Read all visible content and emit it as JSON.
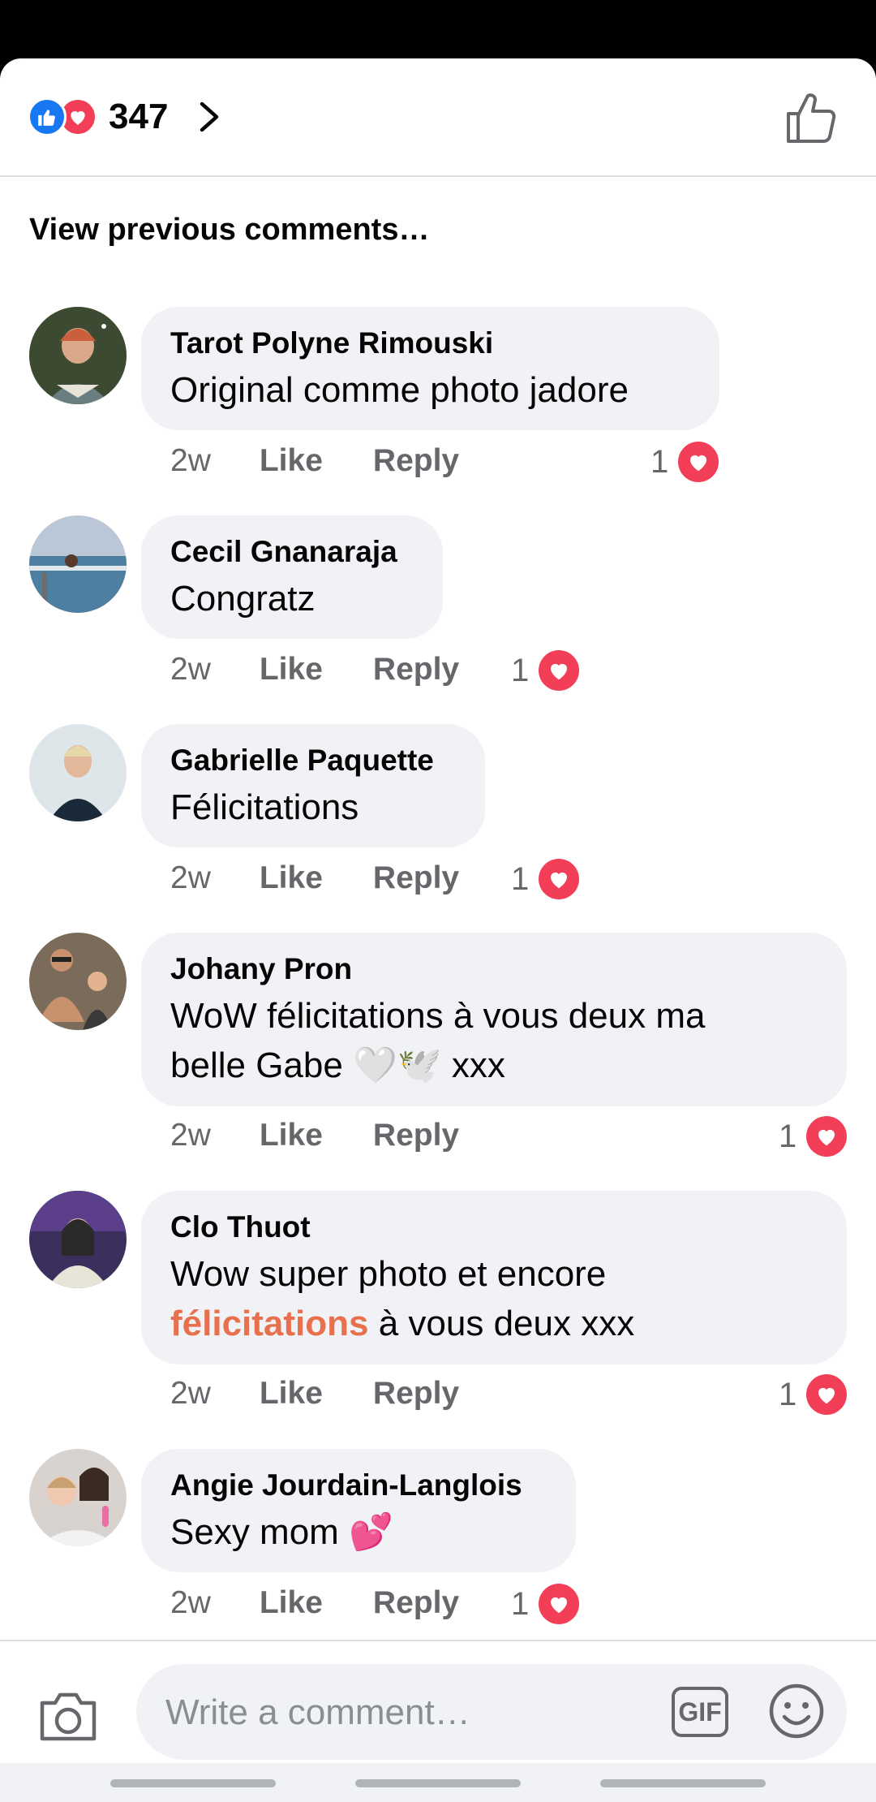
{
  "header": {
    "reaction_count": "347"
  },
  "view_previous": "View previous comments…",
  "comments": [
    {
      "author": "Tarot Polyne Rimouski",
      "text": "Original comme photo  jadore",
      "time": "2w",
      "like": "Like",
      "reply": "Reply",
      "reactions": "1"
    },
    {
      "author": "Cecil Gnanaraja",
      "text": "Congratz",
      "time": "2w",
      "like": "Like",
      "reply": "Reply",
      "reactions": "1"
    },
    {
      "author": "Gabrielle Paquette",
      "text": "Félicitations",
      "time": "2w",
      "like": "Like",
      "reply": "Reply",
      "reactions": "1"
    },
    {
      "author": "Johany Pron",
      "text_line1": "WoW félicitations à vous deux ma",
      "text_line2": "belle Gabe 🤍🕊️ xxx",
      "time": "2w",
      "like": "Like",
      "reply": "Reply",
      "reactions": "1"
    },
    {
      "author": "Clo Thuot",
      "text_line1": "Wow super photo et encore",
      "highlight": "félicitations",
      "text_line2_rest": " à vous deux xxx",
      "time": "2w",
      "like": "Like",
      "reply": "Reply",
      "reactions": "1"
    },
    {
      "author": "Angie Jourdain-Langlois",
      "text": "Sexy mom 💕",
      "time": "2w",
      "like": "Like",
      "reply": "Reply",
      "reactions": "1"
    }
  ],
  "composer": {
    "placeholder": "Write a comment…",
    "gif_label": "GIF"
  },
  "colors": {
    "like_blue": "#1877f2",
    "love_red": "#f33e58",
    "bubble_bg": "#f0f2f5",
    "highlight": "#e9704c"
  },
  "icons": [
    "like-reaction-icon",
    "love-reaction-icon",
    "chevron-right-icon",
    "thumbs-up-icon",
    "camera-icon",
    "gif-icon",
    "emoji-icon"
  ]
}
